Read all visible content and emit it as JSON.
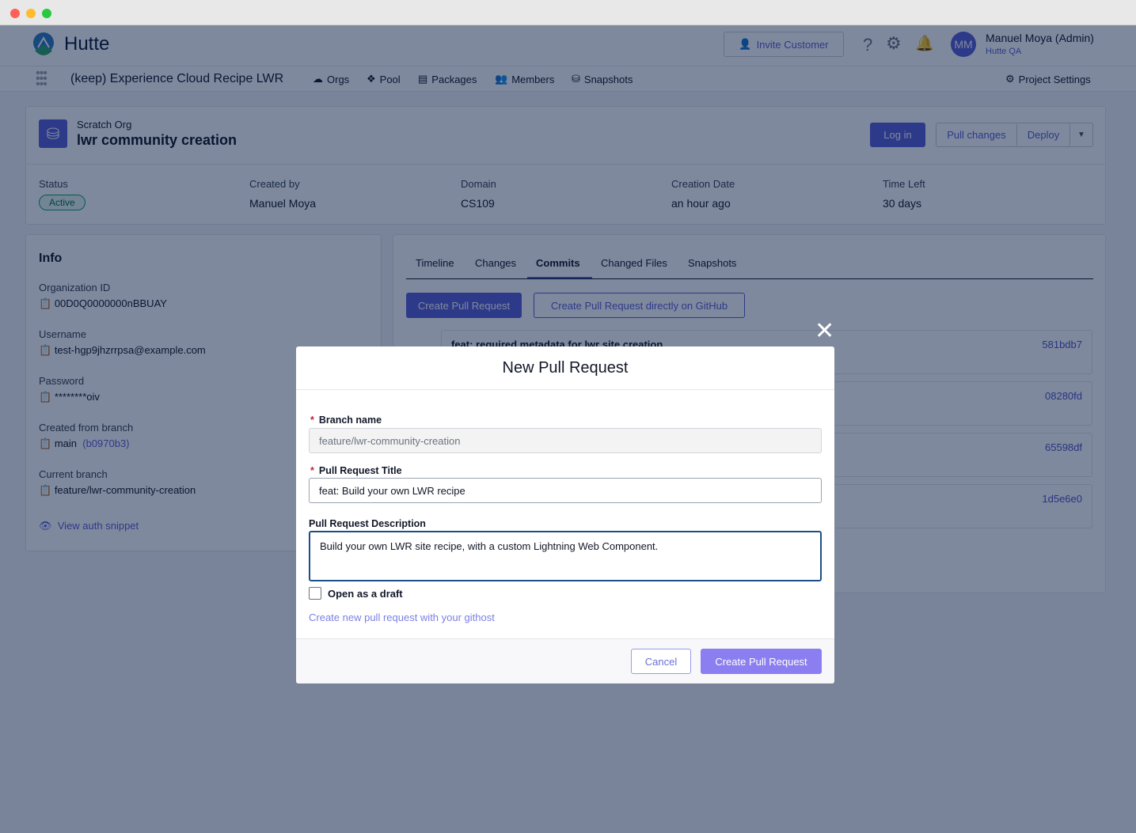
{
  "app": {
    "name": "Hutte",
    "project": "(keep) Experience Cloud Recipe LWR"
  },
  "nav": {
    "items": [
      {
        "label": "Orgs",
        "icon": "cloud-icon"
      },
      {
        "label": "Pool",
        "icon": "pool-icon"
      },
      {
        "label": "Packages",
        "icon": "archive-icon"
      },
      {
        "label": "Members",
        "icon": "users-icon"
      },
      {
        "label": "Snapshots",
        "icon": "database-icon"
      }
    ],
    "project_settings": "Project Settings"
  },
  "header": {
    "invite": "Invite Customer",
    "user_initials": "MM",
    "user_name": "Manuel Moya (Admin)",
    "org": "Hutte QA"
  },
  "org": {
    "type": "Scratch Org",
    "name": "lwr community creation",
    "login": "Log in",
    "pull": "Pull changes",
    "deploy": "Deploy",
    "stats": [
      {
        "label": "Status",
        "value": "Active"
      },
      {
        "label": "Created by",
        "value": "Manuel Moya"
      },
      {
        "label": "Domain",
        "value": "CS109"
      },
      {
        "label": "Creation Date",
        "value": "an hour ago"
      },
      {
        "label": "Time Left",
        "value": "30 days"
      }
    ]
  },
  "info": {
    "title": "Info",
    "fields": [
      {
        "label": "Organization ID",
        "value": "00D0Q0000000nBBUAY"
      },
      {
        "label": "Username",
        "value": "test-hgp9jhzrrpsa@example.com"
      },
      {
        "label": "Password",
        "value": "********oiv"
      },
      {
        "label": "Created from branch",
        "value": "main",
        "extra": "(b0970b3)"
      },
      {
        "label": "Current branch",
        "value": "feature/lwr-community-creation"
      }
    ],
    "auth_snippet": "View auth snippet"
  },
  "tabs": [
    {
      "label": "Timeline"
    },
    {
      "label": "Changes"
    },
    {
      "label": "Commits",
      "active": true
    },
    {
      "label": "Changed Files"
    },
    {
      "label": "Snapshots"
    }
  ],
  "commits_actions": {
    "create_pr": "Create Pull Request",
    "create_pr_github": "Create Pull Request directly on GitHub"
  },
  "commits": [
    {
      "message": "feat: required metadata for lwr site creation",
      "sha": "581bdb7"
    },
    {
      "message": "",
      "sha": "08280fd"
    },
    {
      "message": "",
      "sha": "65598df"
    },
    {
      "message": "",
      "sha": "1d5e6e0"
    }
  ],
  "modal": {
    "title": "New Pull Request",
    "branch_label": "Branch name",
    "branch_value": "feature/lwr-community-creation",
    "title_label": "Pull Request Title",
    "title_value": "feat: Build your own LWR recipe",
    "desc_label": "Pull Request Description",
    "desc_value": "Build your own LWR site recipe, with a custom Lightning Web Component.",
    "draft_label": "Open as a draft",
    "draft_checked": false,
    "githost_link": "Create new pull request with your githost",
    "cancel": "Cancel",
    "submit": "Create Pull Request"
  },
  "colors": {
    "accent": "#5b5fd6",
    "status_active": "#0e9f6e"
  }
}
